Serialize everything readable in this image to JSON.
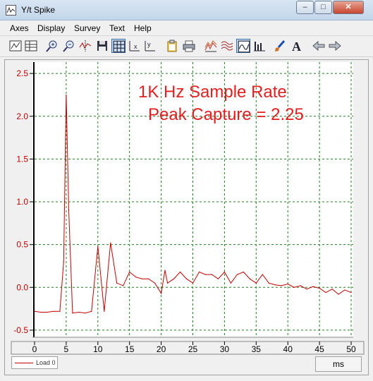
{
  "window": {
    "title": "Y/t Spike"
  },
  "menu": [
    "Axes",
    "Display",
    "Survey",
    "Text",
    "Help"
  ],
  "toolbar": {
    "icons": [
      "chart-view-icon",
      "table-view-icon",
      "zoom-in-icon",
      "zoom-out-icon",
      "cursor-probe-icon",
      "save-icon",
      "grid-icon",
      "x-axis-icon",
      "y-axis-icon",
      "clipboard-icon",
      "print-icon",
      "waterfall-icon",
      "contour-icon",
      "line-plot-icon",
      "bar-plot-icon",
      "brush-icon",
      "text-icon",
      "back-arrow-icon",
      "forward-arrow-icon"
    ],
    "active": [
      "grid-icon",
      "line-plot-icon"
    ]
  },
  "annotation": {
    "line1": "1K Hz Sample Rate",
    "line2": "Peak Capture = 2.25",
    "color": "#e02020"
  },
  "legend": {
    "label": "Load 0",
    "color": "#c00000"
  },
  "units": {
    "label": "ms"
  },
  "chart_data": {
    "type": "line",
    "title": "",
    "xlabel": "",
    "ylabel": "",
    "xlim": [
      0,
      50
    ],
    "ylim": [
      -0.55,
      2.6
    ],
    "x_ticks": [
      0,
      5,
      10,
      15,
      20,
      25,
      30,
      35,
      40,
      45,
      50
    ],
    "y_ticks": [
      -0.5,
      0.0,
      0.5,
      1.0,
      1.5,
      2.0,
      2.5
    ],
    "y_tick_labels": [
      "-0.5",
      "0.0",
      "0.5",
      "1.0",
      "1.5",
      "2.0",
      "2.5"
    ],
    "grid": true,
    "series": [
      {
        "name": "Load 0",
        "color": "#c00000",
        "points": [
          [
            0,
            -0.28
          ],
          [
            1,
            -0.29
          ],
          [
            2,
            -0.29
          ],
          [
            3,
            -0.28
          ],
          [
            4,
            -0.28
          ],
          [
            4.6,
            0.3
          ],
          [
            5,
            2.25
          ],
          [
            5.4,
            0.9
          ],
          [
            6,
            -0.3
          ],
          [
            7,
            -0.29
          ],
          [
            8,
            -0.3
          ],
          [
            9,
            -0.28
          ],
          [
            10,
            0.48
          ],
          [
            11,
            -0.28
          ],
          [
            12,
            0.52
          ],
          [
            13,
            0.05
          ],
          [
            14,
            0.02
          ],
          [
            15,
            0.18
          ],
          [
            16,
            0.12
          ],
          [
            17,
            0.1
          ],
          [
            18,
            0.1
          ],
          [
            19,
            0.05
          ],
          [
            20,
            -0.07
          ],
          [
            20.6,
            0.2
          ],
          [
            21,
            0.05
          ],
          [
            22,
            0.1
          ],
          [
            23,
            0.18
          ],
          [
            24,
            0.1
          ],
          [
            25,
            0.05
          ],
          [
            26,
            0.18
          ],
          [
            27,
            0.15
          ],
          [
            28,
            0.15
          ],
          [
            29,
            0.1
          ],
          [
            30,
            0.18
          ],
          [
            31,
            0.05
          ],
          [
            32,
            0.15
          ],
          [
            33,
            0.18
          ],
          [
            34,
            0.1
          ],
          [
            35,
            0.05
          ],
          [
            36,
            0.15
          ],
          [
            37,
            0.05
          ],
          [
            38,
            0.03
          ],
          [
            39,
            0.02
          ],
          [
            40,
            0.04
          ],
          [
            41,
            0.0
          ],
          [
            42,
            0.02
          ],
          [
            43,
            -0.02
          ],
          [
            44,
            0.01
          ],
          [
            45,
            -0.01
          ],
          [
            46,
            -0.06
          ],
          [
            47,
            -0.02
          ],
          [
            48,
            -0.08
          ],
          [
            49,
            -0.03
          ],
          [
            50,
            -0.06
          ]
        ]
      }
    ],
    "line_color": "#c00000",
    "grid_color": "#208020",
    "legend_position": "bottom-left"
  }
}
